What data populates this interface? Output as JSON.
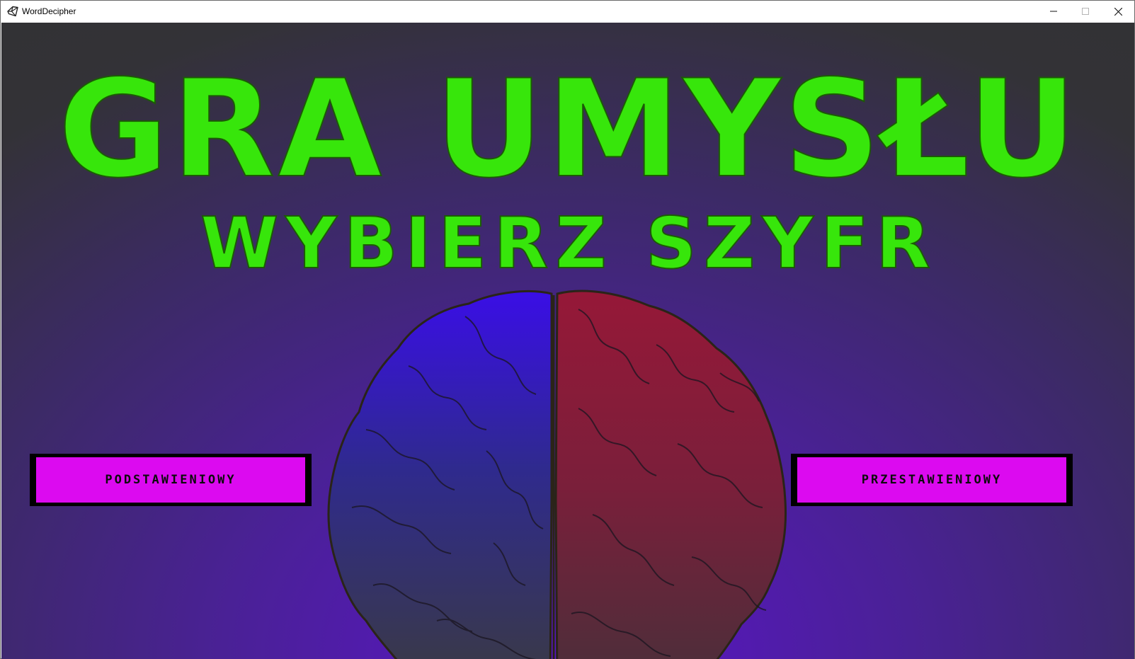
{
  "window": {
    "title": "WordDecipher",
    "icons": {
      "app": "unity-icon",
      "minimize": "minimize-icon",
      "maximize": "maximize-icon",
      "close": "close-icon"
    }
  },
  "game": {
    "title": "GRA UMYSŁU",
    "subtitle": "WYBIERZ SZYFR",
    "buttons": {
      "left_label": "PODSTAWIENIOWY",
      "right_label": "PRZESTAWIENIOWY"
    },
    "colors": {
      "title": "#37e60b",
      "button_fill": "#dc0af0",
      "button_border": "#000000",
      "brain_left": "#3a0ee6",
      "brain_right": "#9a1538",
      "background_top": "#323233",
      "background_bottom": "#5a14c8"
    }
  }
}
